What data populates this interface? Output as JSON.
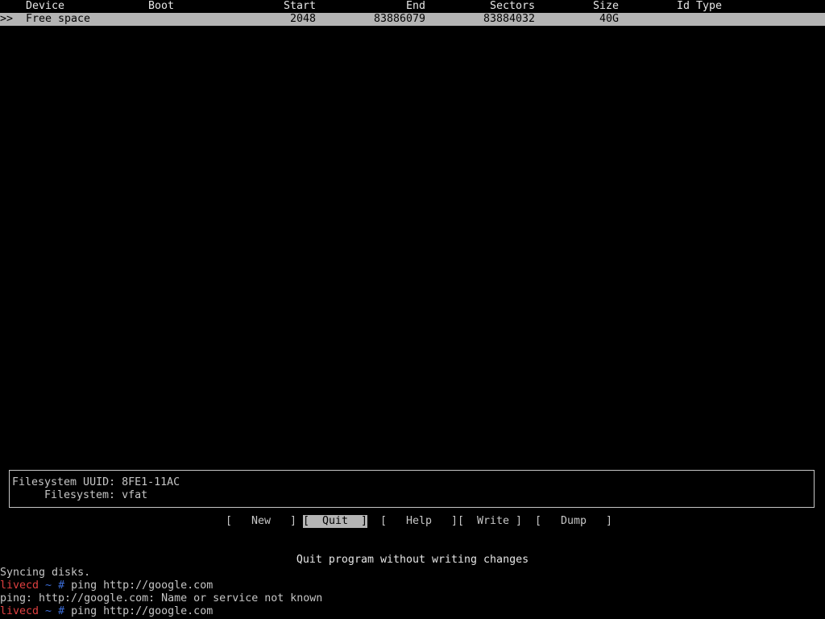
{
  "table": {
    "headers": {
      "device": "Device",
      "boot": "Boot",
      "start": "Start",
      "end": "End",
      "sectors": "Sectors",
      "size": "Size",
      "id_type": "Id Type"
    },
    "rows": [
      {
        "marker": ">>",
        "device": "Free space",
        "boot": "",
        "start": "2048",
        "end": "83886079",
        "sectors": "83884032",
        "size": "40G",
        "id_type": ""
      }
    ]
  },
  "info": {
    "uuid_label": "Filesystem UUID:",
    "uuid_value": "8FE1-11AC",
    "fs_label": "Filesystem:",
    "fs_value": "vfat"
  },
  "menu": {
    "new": "[   New   ]",
    "quit": "[  Quit  ]",
    "help": "[   Help   ]",
    "write": "[  Write ]",
    "dump": "[   Dump   ]",
    "selected": "quit"
  },
  "hint": "Quit program without writing changes",
  "terminal": {
    "line1": "Syncing disks.",
    "prompt1_host": "livecd",
    "prompt1_sym": " ~ #",
    "prompt1_cmd": " ping http://google.com",
    "line3": "ping: http://google.com: Name or service not known",
    "prompt2_host": "livecd",
    "prompt2_sym": " ~ #",
    "prompt2_cmd": " ping http://google.com"
  },
  "colors": {
    "background": "#000000",
    "text": "#c6c6c6",
    "selection": "#b4b4b4",
    "prompt_host": "#e04040",
    "prompt_symbol": "#3b6cd6"
  }
}
